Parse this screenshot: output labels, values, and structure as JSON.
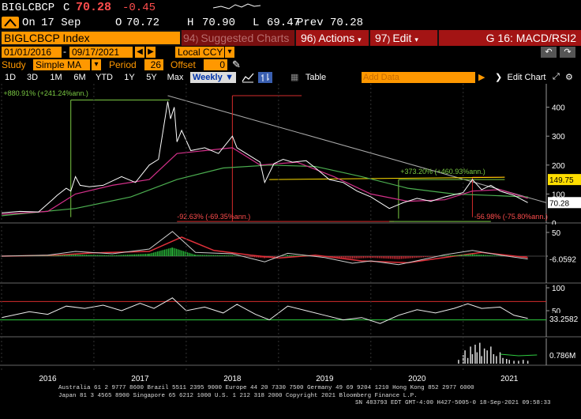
{
  "quote": {
    "ticker": "BIGLCBCP",
    "close_label": "C",
    "close": "70.28",
    "change": "-0.45",
    "trend_label": "On",
    "date": "17 Sep",
    "open_label": "O",
    "open": "70.72",
    "high_label": "H",
    "high": "70.90",
    "low_label": "L",
    "low": "69.47",
    "prev_label": "Prev",
    "prev": "70.28"
  },
  "header": {
    "security": "BIGLCBCP Index",
    "suggested": "Suggested Charts",
    "suggested_num": "94",
    "actions": "Actions",
    "actions_num": "96",
    "edit": "Edit",
    "edit_num": "97",
    "chart_name": "G 16: MACD/RSI2"
  },
  "range": {
    "start": "01/01/2016",
    "end": "09/17/2021",
    "currency": "Local CCY"
  },
  "study": {
    "label": "Study",
    "value": "Simple MA",
    "period_label": "Period",
    "period": "26",
    "offset_label": "Offset",
    "offset": "0"
  },
  "toolbar": {
    "periods": [
      "1D",
      "3D",
      "1M",
      "6M",
      "YTD",
      "1Y",
      "5Y",
      "Max"
    ],
    "frequency": "Weekly",
    "table": "Table",
    "add_data_placeholder": "Add Data",
    "edit_chart": "Edit Chart"
  },
  "colors": {
    "accent_orange": "#ff9800",
    "header_red": "#a31414",
    "up_green": "#2ecc40",
    "down_red": "#e0303a",
    "price_white": "#ffffff",
    "ma_magenta": "#d4308a",
    "ma_green": "#4caf50",
    "last_price_bg": "#ffffff",
    "target_bg": "#ffde00"
  },
  "chart_data": {
    "type": "line",
    "x_labels": [
      "2016",
      "2017",
      "2018",
      "2019",
      "2020",
      "2021"
    ],
    "price_panel": {
      "y_ticks": [
        0,
        100,
        200,
        300,
        400
      ],
      "ylim": [
        0,
        470
      ],
      "price": [
        [
          2016.0,
          35
        ],
        [
          2016.2,
          40
        ],
        [
          2016.4,
          38
        ],
        [
          2016.55,
          80
        ],
        [
          2016.6,
          95
        ],
        [
          2016.7,
          120
        ],
        [
          2016.75,
          110
        ],
        [
          2016.8,
          160
        ],
        [
          2016.85,
          130
        ],
        [
          2016.95,
          125
        ],
        [
          2017.1,
          130
        ],
        [
          2017.3,
          160
        ],
        [
          2017.45,
          140
        ],
        [
          2017.6,
          200
        ],
        [
          2017.7,
          220
        ],
        [
          2017.8,
          420
        ],
        [
          2017.83,
          360
        ],
        [
          2017.87,
          400
        ],
        [
          2017.9,
          280
        ],
        [
          2017.95,
          320
        ],
        [
          2018.05,
          250
        ],
        [
          2018.2,
          260
        ],
        [
          2018.35,
          240
        ],
        [
          2018.5,
          300
        ],
        [
          2018.55,
          260
        ],
        [
          2018.65,
          240
        ],
        [
          2018.8,
          210
        ],
        [
          2018.85,
          140
        ],
        [
          2018.95,
          205
        ],
        [
          2019.05,
          220
        ],
        [
          2019.15,
          210
        ],
        [
          2019.3,
          215
        ],
        [
          2019.4,
          190
        ],
        [
          2019.55,
          150
        ],
        [
          2019.7,
          140
        ],
        [
          2019.85,
          110
        ],
        [
          2020.0,
          90
        ],
        [
          2020.2,
          50
        ],
        [
          2020.35,
          70
        ],
        [
          2020.5,
          85
        ],
        [
          2020.65,
          75
        ],
        [
          2020.8,
          90
        ],
        [
          2021.0,
          105
        ],
        [
          2021.1,
          150
        ],
        [
          2021.2,
          115
        ],
        [
          2021.3,
          130
        ],
        [
          2021.4,
          110
        ],
        [
          2021.55,
          95
        ],
        [
          2021.7,
          70.28
        ]
      ],
      "ma_fast": [
        [
          2016.0,
          30
        ],
        [
          2016.5,
          40
        ],
        [
          2016.8,
          100
        ],
        [
          2017.2,
          130
        ],
        [
          2017.6,
          150
        ],
        [
          2017.9,
          240
        ],
        [
          2018.2,
          250
        ],
        [
          2018.5,
          260
        ],
        [
          2018.8,
          200
        ],
        [
          2019.2,
          210
        ],
        [
          2019.6,
          160
        ],
        [
          2020.0,
          100
        ],
        [
          2020.4,
          75
        ],
        [
          2020.8,
          80
        ],
        [
          2021.1,
          110
        ],
        [
          2021.4,
          115
        ],
        [
          2021.7,
          85
        ]
      ],
      "ma_slow": [
        [
          2016.0,
          25
        ],
        [
          2016.8,
          50
        ],
        [
          2017.4,
          90
        ],
        [
          2017.9,
          150
        ],
        [
          2018.4,
          190
        ],
        [
          2018.9,
          200
        ],
        [
          2019.4,
          195
        ],
        [
          2019.9,
          160
        ],
        [
          2020.4,
          120
        ],
        [
          2020.9,
          100
        ],
        [
          2021.3,
          95
        ],
        [
          2021.7,
          90
        ]
      ],
      "last_price": "70.28",
      "target_price": "149.75",
      "annotations": {
        "gain_top": "+880.91% (+241.24%ann.)",
        "drop_mid": "-92.63% (-69.35%ann.)",
        "gain_right": "+373.20% (+460.93%ann.)",
        "drop_right": "-56.98% (-75.80%ann.)"
      }
    },
    "macd_panel": {
      "y_ticks": [
        50,
        0
      ],
      "last_value": "-6.0592",
      "macd": [
        [
          2016.0,
          0
        ],
        [
          2016.5,
          2
        ],
        [
          2016.8,
          10
        ],
        [
          2017.2,
          5
        ],
        [
          2017.6,
          15
        ],
        [
          2017.85,
          52
        ],
        [
          2018.1,
          8
        ],
        [
          2018.5,
          5
        ],
        [
          2018.85,
          -12
        ],
        [
          2019.1,
          6
        ],
        [
          2019.5,
          -3
        ],
        [
          2019.8,
          -15
        ],
        [
          2020.0,
          -10
        ],
        [
          2020.3,
          -18
        ],
        [
          2020.8,
          3
        ],
        [
          2021.1,
          12
        ],
        [
          2021.4,
          2
        ],
        [
          2021.7,
          -6.06
        ]
      ],
      "signal": [
        [
          2016.0,
          0
        ],
        [
          2016.6,
          2
        ],
        [
          2017.0,
          7
        ],
        [
          2017.6,
          10
        ],
        [
          2017.95,
          40
        ],
        [
          2018.3,
          12
        ],
        [
          2018.7,
          2
        ],
        [
          2019.0,
          -4
        ],
        [
          2019.4,
          2
        ],
        [
          2019.9,
          -10
        ],
        [
          2020.4,
          -14
        ],
        [
          2020.9,
          0
        ],
        [
          2021.2,
          8
        ],
        [
          2021.7,
          -3
        ]
      ]
    },
    "rsi_panel": {
      "y_ticks": [
        100,
        50
      ],
      "levels": [
        70,
        30
      ],
      "last_value": "33.2582",
      "rsi": [
        [
          2016.0,
          35
        ],
        [
          2016.3,
          48
        ],
        [
          2016.5,
          42
        ],
        [
          2016.7,
          60
        ],
        [
          2016.9,
          55
        ],
        [
          2017.1,
          62
        ],
        [
          2017.3,
          50
        ],
        [
          2017.5,
          66
        ],
        [
          2017.65,
          55
        ],
        [
          2017.85,
          78
        ],
        [
          2018.0,
          50
        ],
        [
          2018.2,
          58
        ],
        [
          2018.4,
          45
        ],
        [
          2018.55,
          64
        ],
        [
          2018.75,
          42
        ],
        [
          2018.9,
          30
        ],
        [
          2019.1,
          60
        ],
        [
          2019.3,
          50
        ],
        [
          2019.5,
          40
        ],
        [
          2019.7,
          30
        ],
        [
          2019.9,
          35
        ],
        [
          2020.1,
          22
        ],
        [
          2020.3,
          40
        ],
        [
          2020.5,
          52
        ],
        [
          2020.7,
          45
        ],
        [
          2020.9,
          55
        ],
        [
          2021.05,
          65
        ],
        [
          2021.2,
          55
        ],
        [
          2021.4,
          58
        ],
        [
          2021.55,
          40
        ],
        [
          2021.7,
          33.26
        ]
      ]
    },
    "volume_panel": {
      "last_value": "0.786M",
      "bars": [
        [
          2020.95,
          4
        ],
        [
          2021.0,
          9
        ],
        [
          2021.02,
          14
        ],
        [
          2021.05,
          6
        ],
        [
          2021.08,
          18
        ],
        [
          2021.1,
          10
        ],
        [
          2021.13,
          20
        ],
        [
          2021.15,
          12
        ],
        [
          2021.18,
          22
        ],
        [
          2021.2,
          8
        ],
        [
          2021.23,
          16
        ],
        [
          2021.26,
          14
        ],
        [
          2021.3,
          18
        ],
        [
          2021.33,
          10
        ],
        [
          2021.36,
          8
        ],
        [
          2021.4,
          12
        ],
        [
          2021.43,
          6
        ],
        [
          2021.47,
          5
        ],
        [
          2021.5,
          4
        ],
        [
          2021.55,
          3
        ],
        [
          2021.6,
          3
        ],
        [
          2021.65,
          4
        ],
        [
          2021.7,
          3
        ]
      ]
    }
  },
  "footer": {
    "line1": "Australia 61 2 9777 8600 Brazil 5511 2395 9000 Europe 44 20 7330 7500 Germany 49 69 9204 1210 Hong Kong 852 2977 6000",
    "line2": "Japan 81 3 4565 8900        Singapore 65 6212 1000        U.S. 1 212 318 2000                Copyright 2021 Bloomberg Finance L.P.",
    "line3": "SN 483793 EDT  GMT-4:00 H427-5005-0 18-Sep-2021 09:58:33"
  }
}
